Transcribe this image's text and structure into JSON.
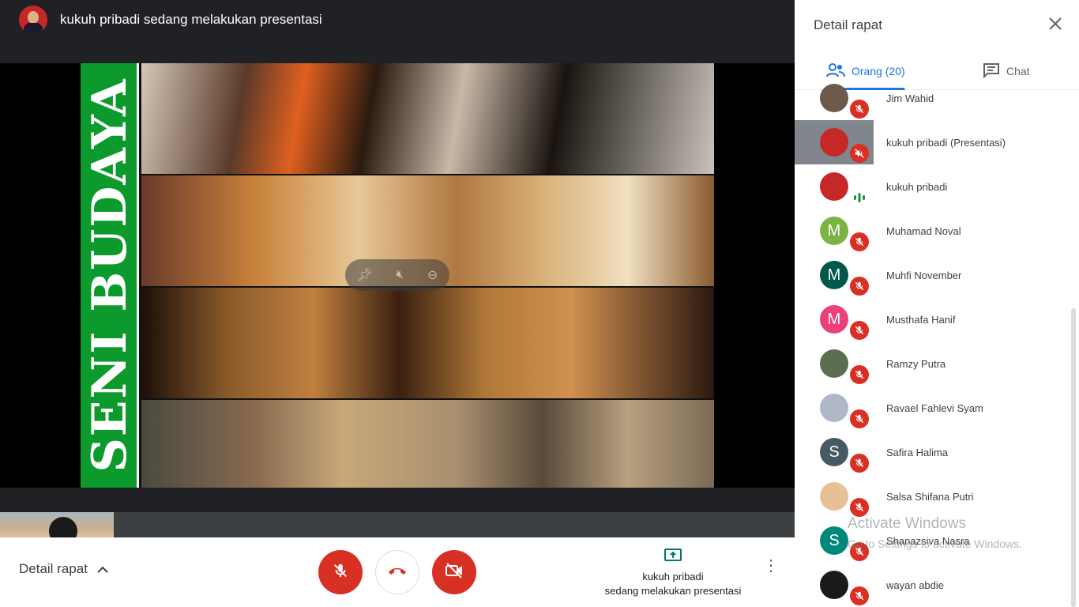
{
  "topbar": {
    "title": "kukuh pribadi sedang melakukan presentasi"
  },
  "slide": {
    "vertical_text": "SENI BUDAYA"
  },
  "bottombar": {
    "details_label": "Detail rapat",
    "present_line1": "kukuh pribadi",
    "present_line2": "sedang melakukan presentasi"
  },
  "side": {
    "title": "Detail rapat",
    "tabs": [
      {
        "label": "Orang (20)"
      },
      {
        "label": "Chat"
      }
    ],
    "people": [
      {
        "name": "Jim Wahid",
        "initial": "",
        "color": "#6d5a4a",
        "status": "muted"
      },
      {
        "name": "kukuh pribadi (Presentasi)",
        "initial": "",
        "color": "#c62828",
        "status": "muted-speaker"
      },
      {
        "name": "kukuh pribadi",
        "initial": "",
        "color": "#c62828",
        "status": "talking"
      },
      {
        "name": "Muhamad Noval",
        "initial": "M",
        "color": "#7cb342",
        "status": "muted"
      },
      {
        "name": "Muhfi November",
        "initial": "M",
        "color": "#00574b",
        "status": "muted"
      },
      {
        "name": "Musthafa Hanif",
        "initial": "M",
        "color": "#ec407a",
        "status": "muted"
      },
      {
        "name": "Ramzy Putra",
        "initial": "",
        "color": "#5b6e4f",
        "status": "muted"
      },
      {
        "name": "Ravael Fahlevi Syam",
        "initial": "",
        "color": "#b0b8c8",
        "status": "muted"
      },
      {
        "name": "Safira Halima",
        "initial": "S",
        "color": "#455a64",
        "status": "muted"
      },
      {
        "name": "Salsa Shifana Putri",
        "initial": "",
        "color": "#e8c098",
        "status": "muted"
      },
      {
        "name": "Shanazsiva Nasra",
        "initial": "S",
        "color": "#00897b",
        "status": "muted"
      },
      {
        "name": "wayan abdie",
        "initial": "",
        "color": "#1a1a1a",
        "status": "muted"
      }
    ]
  },
  "watermark": {
    "line1": "Activate Windows",
    "line2": "Go to Settings to activate Windows."
  },
  "colors": {
    "accent": "#1a73e8",
    "danger": "#d93025",
    "brand_green": "#0b9a2b"
  }
}
